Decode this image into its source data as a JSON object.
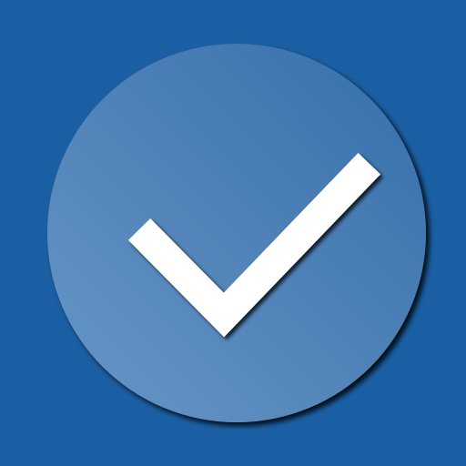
{
  "icon": {
    "name": "check-icon",
    "background_color": "#1a5fa3",
    "circle_color_light": "#5f8fc2",
    "circle_color_dark": "#3d74ae",
    "check_color": "#ffffff"
  }
}
